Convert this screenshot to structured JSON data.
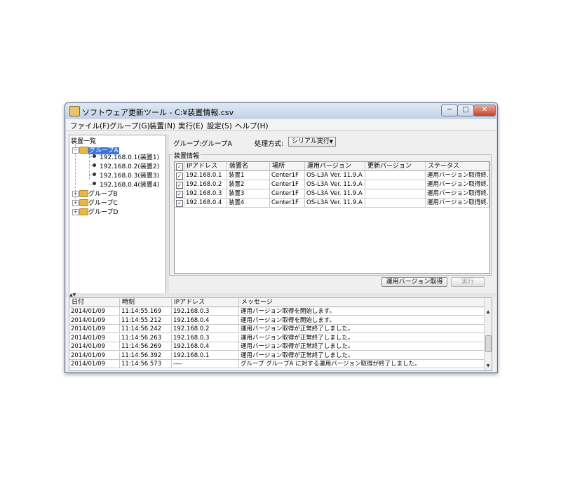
{
  "window": {
    "title": "ソフトウェア更新ツール - C:¥装置情報.csv",
    "controls": {
      "minimize": "─",
      "maximize": "□",
      "close": "✕"
    }
  },
  "menu": [
    "ファイル(F)",
    "グループ(G)",
    "装置(N)",
    "実行(E)",
    "設定(S)",
    "ヘルプ(H)"
  ],
  "tree": {
    "root": "装置一覧",
    "groups": [
      {
        "label": "グループA",
        "expanded": true,
        "selected": true,
        "children": [
          "192.168.0.1(装置1)",
          "192.168.0.2(装置2)",
          "192.168.0.3(装置3)",
          "192.168.0.4(装置4)"
        ]
      },
      {
        "label": "グループB",
        "expanded": false
      },
      {
        "label": "グループC",
        "expanded": false
      },
      {
        "label": "グループD",
        "expanded": false
      }
    ]
  },
  "panel": {
    "group_label": "グループ:",
    "group_value": "グループA",
    "method_label": "処理方式:",
    "method_value": "シリアル実行",
    "device_info_title": "装置情報",
    "columns": [
      "",
      "IPアドレス",
      "装置名",
      "場所",
      "運用バージョン",
      "更新バージョン",
      "ステータス"
    ],
    "rows": [
      {
        "checked": true,
        "ip": "192.168.0.1",
        "name": "装置1",
        "location": "Center1F",
        "version": "OS-L3A Ver. 11.9.A",
        "update": "",
        "status": "運用バージョン取得終..."
      },
      {
        "checked": true,
        "ip": "192.168.0.2",
        "name": "装置2",
        "location": "Center1F",
        "version": "OS-L3A Ver. 11.9.A",
        "update": "",
        "status": "運用バージョン取得終..."
      },
      {
        "checked": true,
        "ip": "192.168.0.3",
        "name": "装置3",
        "location": "Center1F",
        "version": "OS-L3A Ver. 11.9.A",
        "update": "",
        "status": "運用バージョン取得終..."
      },
      {
        "checked": true,
        "ip": "192.168.0.4",
        "name": "装置4",
        "location": "Center1F",
        "version": "OS-L3A Ver. 11.9.A",
        "update": "",
        "status": "運用バージョン取得終..."
      }
    ],
    "btn_get_version": "運用バージョン取得",
    "btn_execute": "実行"
  },
  "log": {
    "columns": [
      "日付",
      "時刻",
      "IPアドレス",
      "メッセージ"
    ],
    "rows": [
      [
        "2014/01/09",
        "11:14:55.169",
        "192.168.0.3",
        "運用バージョン取得を開始します。"
      ],
      [
        "2014/01/09",
        "11:14:55.212",
        "192.168.0.4",
        "運用バージョン取得を開始します。"
      ],
      [
        "2014/01/09",
        "11:14:56.242",
        "192.168.0.2",
        "運用バージョン取得が正常終了しました。"
      ],
      [
        "2014/01/09",
        "11:14:56.263",
        "192.168.0.3",
        "運用バージョン取得が正常終了しました。"
      ],
      [
        "2014/01/09",
        "11:14:56.269",
        "192.168.0.4",
        "運用バージョン取得が正常終了しました。"
      ],
      [
        "2014/01/09",
        "11:14:56.392",
        "192.168.0.1",
        "運用バージョン取得が正常終了しました。"
      ],
      [
        "2014/01/09",
        "11:14:56.573",
        "----",
        "グループ グループA に対する運用バージョン取得が終了しました。"
      ]
    ]
  }
}
